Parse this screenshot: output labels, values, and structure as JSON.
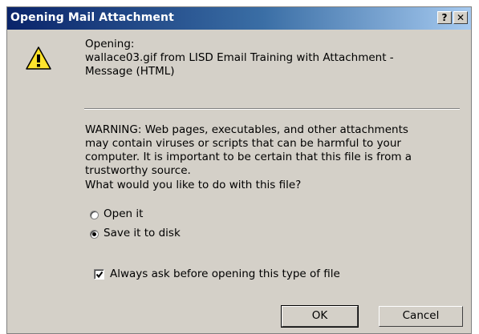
{
  "window": {
    "title": "Opening Mail Attachment",
    "help_label": "?",
    "close_label": "✕"
  },
  "message": {
    "opening_label": "Opening:",
    "file_line1": "wallace03.gif from LISD Email Training with Attachment -",
    "file_line2": "Message (HTML)"
  },
  "warning": {
    "lines": [
      "WARNING: Web pages, executables, and other attachments",
      "may contain viruses or scripts that can be harmful to your",
      "computer. It is important to be certain that this file is from a",
      "trustworthy source."
    ],
    "question": "What would you like to do with this file?"
  },
  "options": {
    "open_label": "Open it",
    "save_label": "Save it to disk",
    "selected": "save"
  },
  "always_ask": {
    "label": "Always ask before opening this type of file",
    "checked": true
  },
  "buttons": {
    "ok_label": "OK",
    "cancel_label": "Cancel"
  },
  "icon": "warning-icon"
}
